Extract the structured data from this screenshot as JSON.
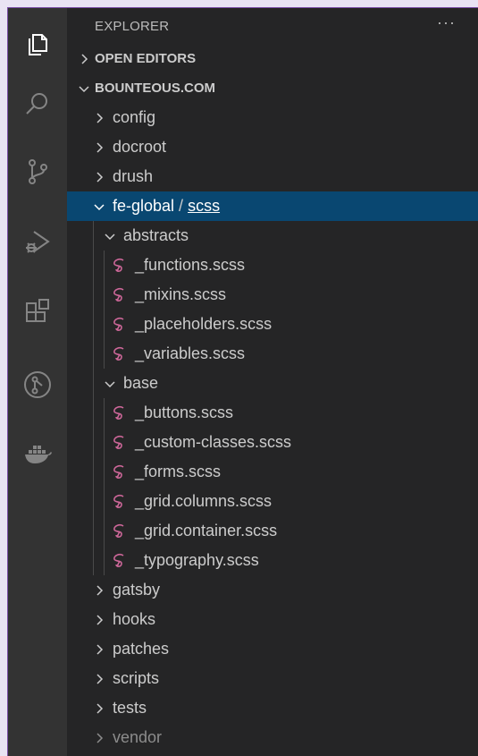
{
  "sidebar": {
    "title": "EXPLORER",
    "more": "···",
    "sections": {
      "open_editors": "OPEN EDITORS",
      "workspace": "BOUNTEOUS.COM"
    }
  },
  "tree": {
    "config": "config",
    "docroot": "docroot",
    "drush": "drush",
    "fe_global": {
      "name": "fe-global",
      "sep": "/",
      "sub": "scss"
    },
    "abstracts": {
      "name": "abstracts",
      "files": [
        "_functions.scss",
        "_mixins.scss",
        "_placeholders.scss",
        "_variables.scss"
      ]
    },
    "base": {
      "name": "base",
      "files": [
        "_buttons.scss",
        "_custom-classes.scss",
        "_forms.scss",
        "_grid.columns.scss",
        "_grid.container.scss",
        "_typography.scss"
      ]
    },
    "gatsby": "gatsby",
    "hooks": "hooks",
    "patches": "patches",
    "scripts": "scripts",
    "tests": "tests",
    "vendor": "vendor"
  },
  "colors": {
    "activity_bar": "#333333",
    "sidebar": "#252526",
    "selection": "#094771",
    "sass_icon": "#cd6799"
  },
  "activity_icons": [
    "explorer-icon",
    "search-icon",
    "source-control-icon",
    "run-debug-icon",
    "extensions-icon",
    "gitlens-icon",
    "docker-icon"
  ]
}
